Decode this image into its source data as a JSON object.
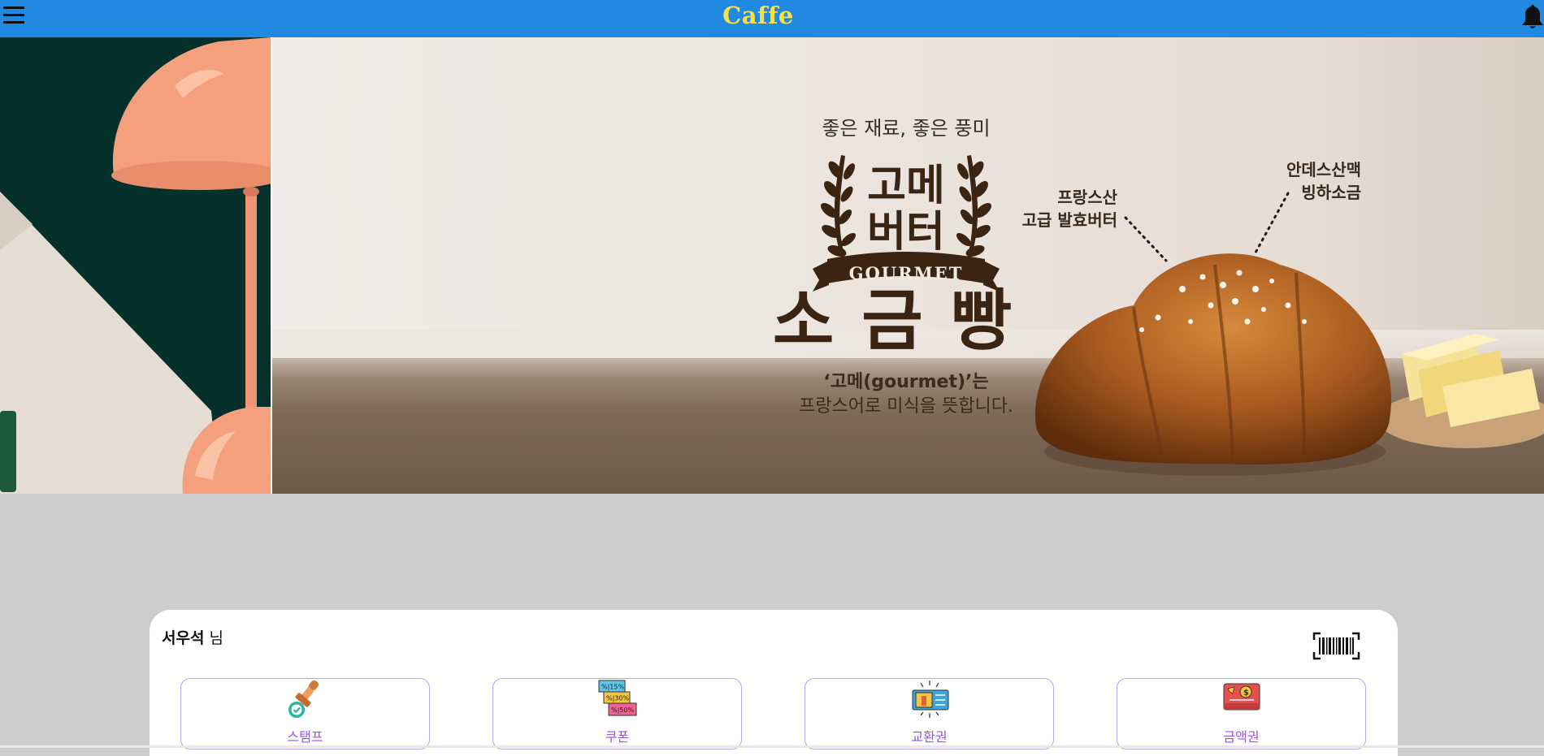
{
  "header": {
    "title": "Caffe",
    "menu_icon": "hamburger-menu-icon",
    "notification_icon": "bell-icon",
    "background_color": "#2189e2",
    "title_color": "#f6e04a"
  },
  "banner": {
    "tagline": "좋은 재료, 좋은 풍미",
    "badge_line1": "고메",
    "badge_line2": "버터",
    "badge_ribbon": "GOURMET",
    "product_name": "소금빵",
    "description_line1": "‘고메(gourmet)’는",
    "description_line2": "프랑스어로 미식을 뜻합니다.",
    "note_butter_line1": "프랑스산",
    "note_butter_line2": "고급 발효버터",
    "note_salt_line1": "안데스산맥",
    "note_salt_line2": "빙하소금"
  },
  "member": {
    "name": "서우석",
    "suffix": " 님",
    "barcode_icon": "barcode-icon"
  },
  "menu_cards": [
    {
      "label": "스탬프",
      "icon": "stamp-icon"
    },
    {
      "label": "쿠폰",
      "icon": "coupon-icon"
    },
    {
      "label": "교환권",
      "icon": "voucher-icon"
    },
    {
      "label": "금액권",
      "icon": "gift-card-icon"
    }
  ]
}
